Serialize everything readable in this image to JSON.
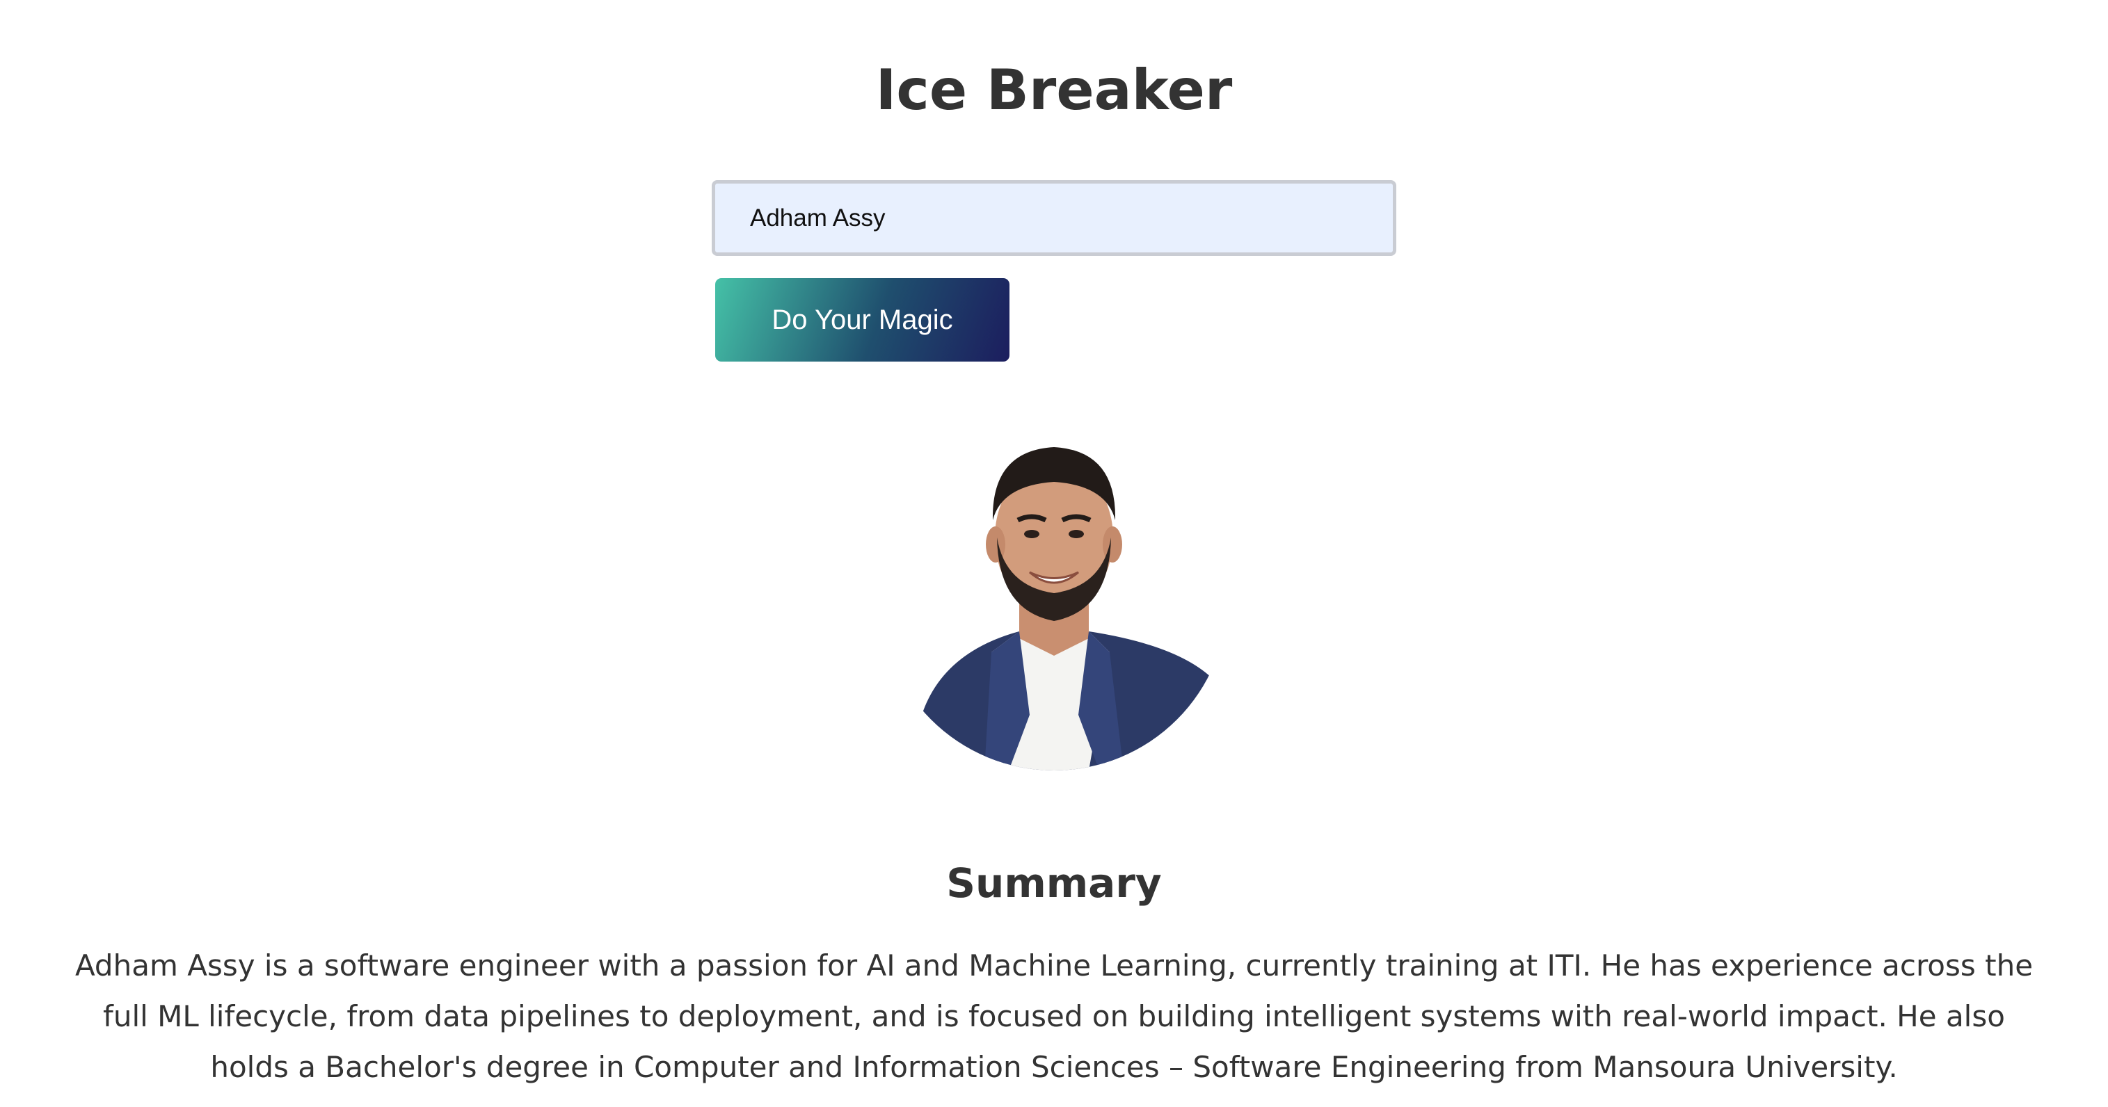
{
  "app": {
    "title": "Ice Breaker"
  },
  "search": {
    "value": "Adham Assy"
  },
  "action": {
    "button_label": "Do Your Magic"
  },
  "profile": {
    "avatar_icon": "profile-photo"
  },
  "summary": {
    "heading": "Summary",
    "text": "Adham Assy is a software engineer with a passion for AI and Machine Learning, currently training at ITI. He has experience across the full ML lifecycle, from data pipelines to deployment, and is focused on building intelligent systems with real-world impact. He also holds a Bachelor's degree in Computer and Information Sciences – Software Engineering from Mansoura University."
  },
  "colors": {
    "input_background": "#e8f0fe",
    "button_gradient_start": "#45c1a7",
    "button_gradient_end": "#1c1d5e",
    "text": "#333333"
  }
}
